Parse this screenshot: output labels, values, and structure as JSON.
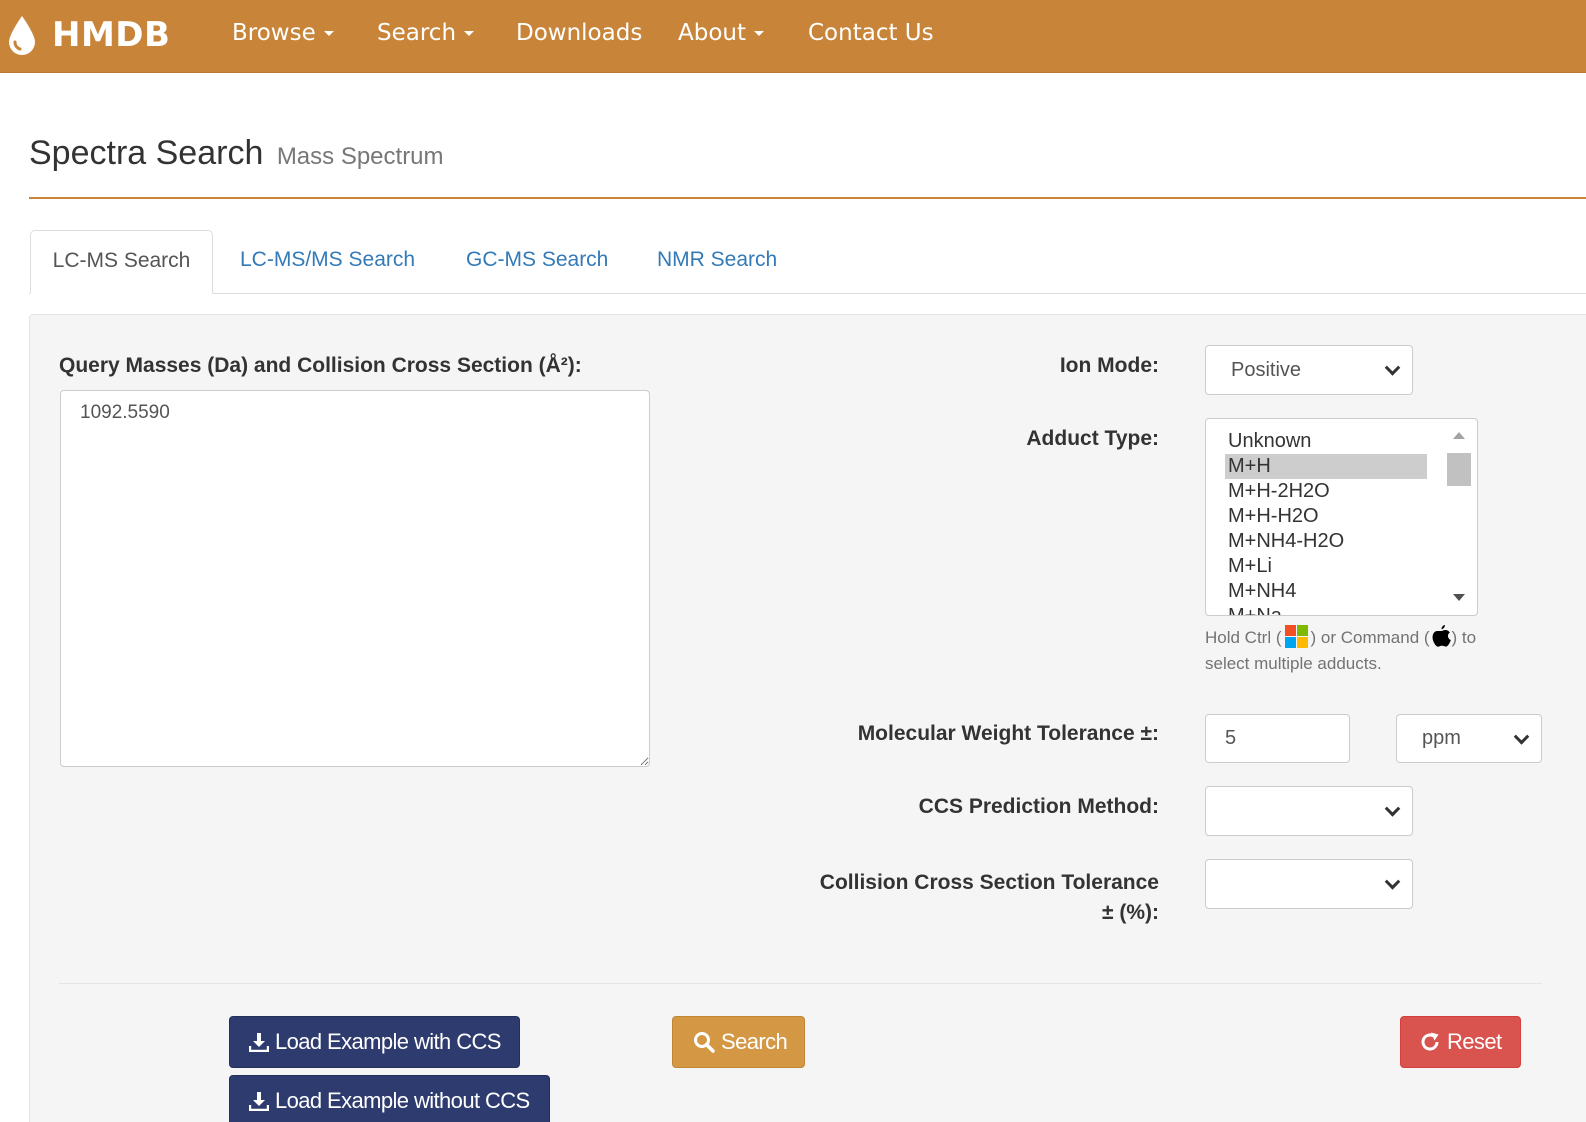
{
  "navbar": {
    "brand": "HMDB",
    "items": [
      {
        "label": "Browse",
        "dropdown": true
      },
      {
        "label": "Search",
        "dropdown": true
      },
      {
        "label": "Downloads",
        "dropdown": false
      },
      {
        "label": "About",
        "dropdown": true
      },
      {
        "label": "Contact Us",
        "dropdown": false
      }
    ]
  },
  "page": {
    "title": "Spectra Search",
    "subtitle": "Mass Spectrum"
  },
  "tabs": [
    {
      "label": "LC-MS Search",
      "active": true
    },
    {
      "label": "LC-MS/MS Search",
      "active": false
    },
    {
      "label": "GC-MS Search",
      "active": false
    },
    {
      "label": "NMR Search",
      "active": false
    }
  ],
  "form": {
    "query_label": "Query Masses (Da) and Collision Cross Section (Å²):",
    "query_value": "1092.5590",
    "ion_mode_label": "Ion Mode:",
    "ion_mode_value": "Positive",
    "adduct_label": "Adduct Type:",
    "adduct_options": [
      "Unknown",
      "M+H",
      "M+H-2H2O",
      "M+H-H2O",
      "M+NH4-H2O",
      "M+Li",
      "M+NH4",
      "M+Na"
    ],
    "adduct_selected": "M+H",
    "help_part1": "Hold Ctrl (",
    "help_part2": ") or Command (",
    "help_part3": ") to select multiple adducts.",
    "mw_tol_label": "Molecular Weight Tolerance ±:",
    "mw_tol_value": "5",
    "mw_tol_unit": "ppm",
    "ccs_method_label": "CCS Prediction Method:",
    "ccs_method_value": "",
    "ccs_tol_label_line1": "Collision Cross Section Tolerance",
    "ccs_tol_label_line2": "± (%):",
    "ccs_tol_value": ""
  },
  "buttons": {
    "load_with_ccs": "Load Example with CCS",
    "load_without_ccs": "Load Example without CCS",
    "search": "Search",
    "reset": "Reset"
  },
  "colors": {
    "navbar": "#c88539",
    "dark_button": "#2e3b6e",
    "search_button": "#d49844",
    "reset_button": "#d9534f",
    "tab_link": "#337ab7"
  }
}
